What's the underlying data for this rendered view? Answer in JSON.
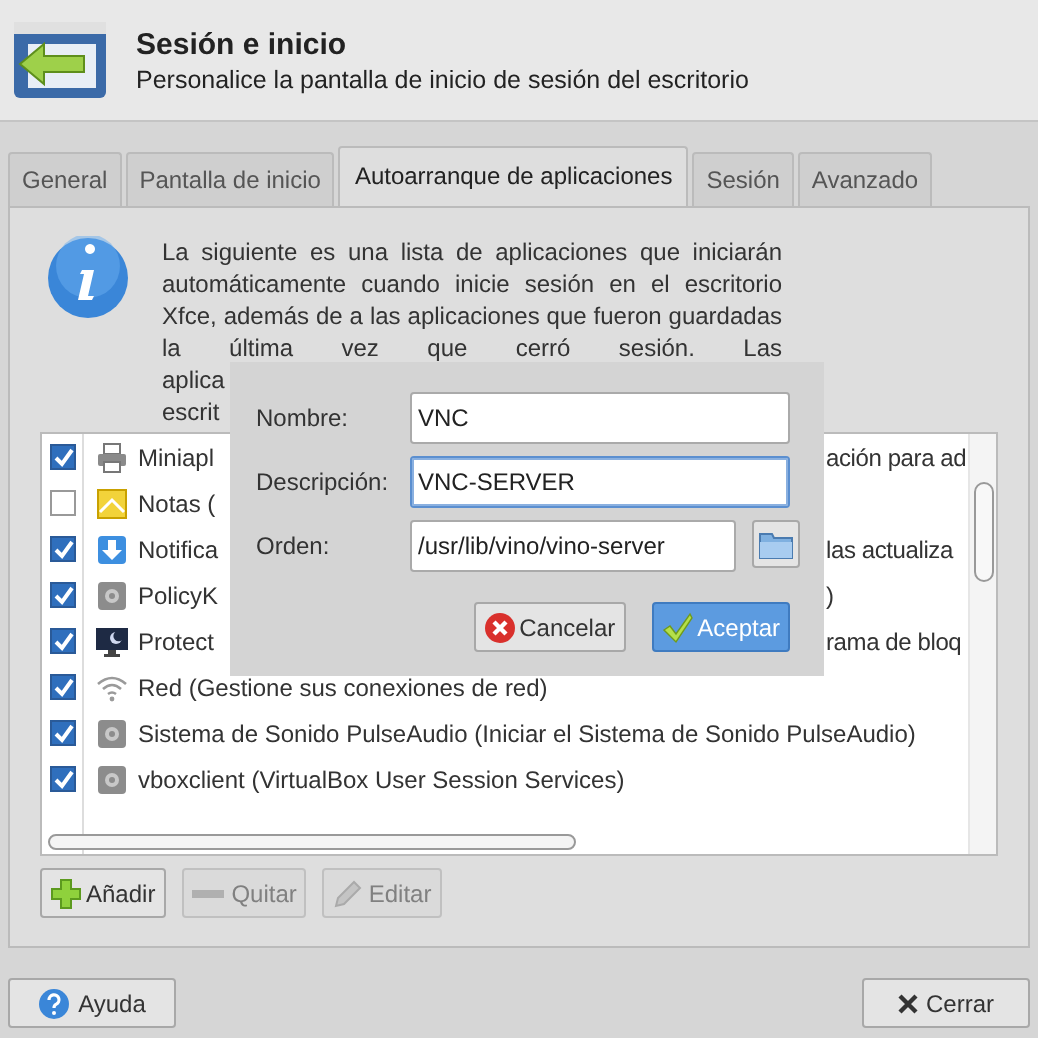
{
  "header": {
    "title": "Sesión e inicio",
    "subtitle": "Personalice la pantalla de inicio de sesión del escritorio"
  },
  "tabs": [
    {
      "label": "General",
      "selected": false
    },
    {
      "label": "Pantalla de inicio",
      "selected": false
    },
    {
      "label": "Autoarranque de aplicaciones",
      "selected": true
    },
    {
      "label": "Sesión",
      "selected": false
    },
    {
      "label": "Avanzado",
      "selected": false
    }
  ],
  "info": {
    "text": "La siguiente es una lista de aplicaciones que iniciarán automáticamente cuando inicie sesión en el escritorio Xfce, además de a las aplicaciones que fueron guardadas la última vez que cerró sesión. Las",
    "fragments": [
      "aplica",
      "escrit"
    ]
  },
  "apps": [
    {
      "checked": true,
      "kind": "printer",
      "label": "Miniapl",
      "tail": "ación para ad"
    },
    {
      "checked": false,
      "kind": "notes",
      "label": "Notas ("
    },
    {
      "checked": true,
      "kind": "download",
      "label": "Notifica",
      "tail": "las actualiza"
    },
    {
      "checked": true,
      "kind": "gear",
      "label": "PolicyK",
      "tail": ")"
    },
    {
      "checked": true,
      "kind": "monitor",
      "label": "Protect",
      "tail": "rama de bloq"
    },
    {
      "checked": true,
      "kind": "wifi",
      "label": "Red (Gestione sus conexiones de red)"
    },
    {
      "checked": true,
      "kind": "gear",
      "label": "Sistema de Sonido PulseAudio (Iniciar el Sistema de Sonido PulseAudio)"
    },
    {
      "checked": true,
      "kind": "gear",
      "label": "vboxclient (VirtualBox User Session Services)"
    }
  ],
  "list_buttons": [
    {
      "kind": "add",
      "label": "Añadir",
      "disabled": false
    },
    {
      "kind": "remove",
      "label": "Quitar",
      "disabled": true
    },
    {
      "kind": "edit",
      "label": "Editar",
      "disabled": true
    }
  ],
  "dialog": {
    "fields": [
      {
        "label": "Nombre:",
        "value": "VNC",
        "focused": false,
        "browse": false
      },
      {
        "label": "Descripción:",
        "value": "VNC-SERVER",
        "focused": true,
        "browse": false
      },
      {
        "label": "Orden:",
        "value": "/usr/lib/vino/vino-server",
        "focused": false,
        "browse": true
      }
    ],
    "buttons": [
      {
        "kind": "cancel",
        "label": "Cancelar"
      },
      {
        "kind": "ok",
        "label": "Aceptar"
      }
    ]
  },
  "footer": {
    "help": "Ayuda",
    "close": "Cerrar"
  }
}
